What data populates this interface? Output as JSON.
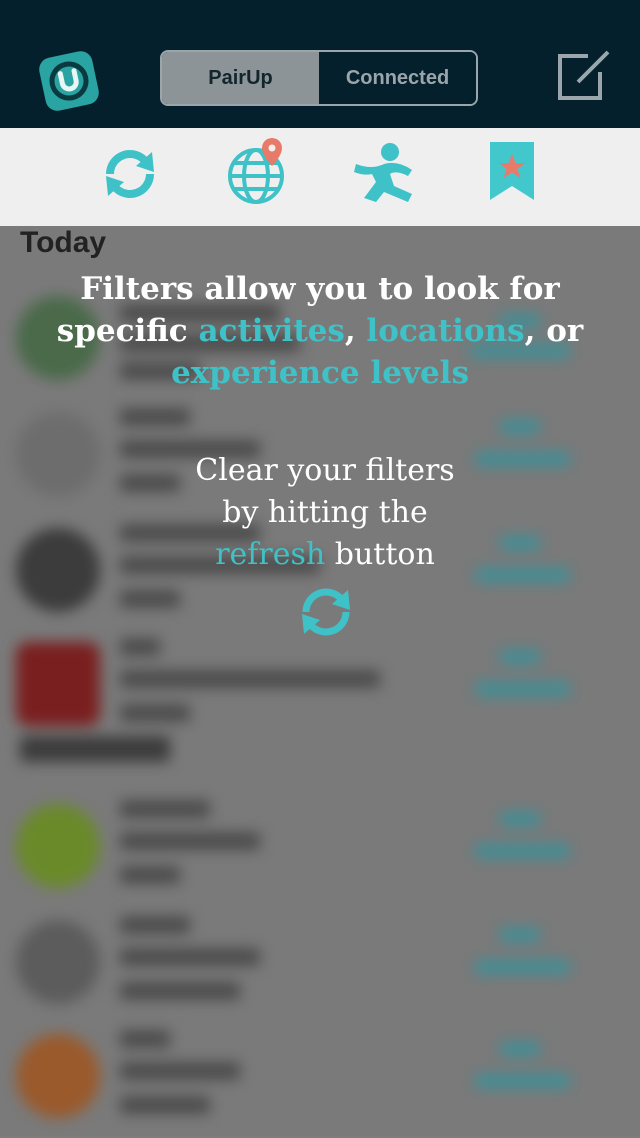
{
  "header": {
    "segments": [
      {
        "label": "PairUp",
        "active": true
      },
      {
        "label": "Connected",
        "active": false
      }
    ]
  },
  "filters": {
    "icons": [
      "refresh-icon",
      "globe-location-icon",
      "activity-person-icon",
      "bookmark-star-icon"
    ]
  },
  "list": {
    "section_today": "Today"
  },
  "overlay": {
    "tip1": {
      "line1": "Filters allow you to look for",
      "prefix": "specific ",
      "activities": "activites",
      "comma1": ", ",
      "locations": "locations",
      "suffix": ", or",
      "experience": "experience levels"
    },
    "tip2": {
      "line1": "Clear your filters",
      "line2": "by hitting the",
      "refresh": "refresh",
      "button_word": " button"
    }
  },
  "colors": {
    "header_bg": "#04202c",
    "accent_teal": "#3ec2c8",
    "pin_coral": "#e87a6a",
    "bookmark_teal": "#42c8cc"
  }
}
